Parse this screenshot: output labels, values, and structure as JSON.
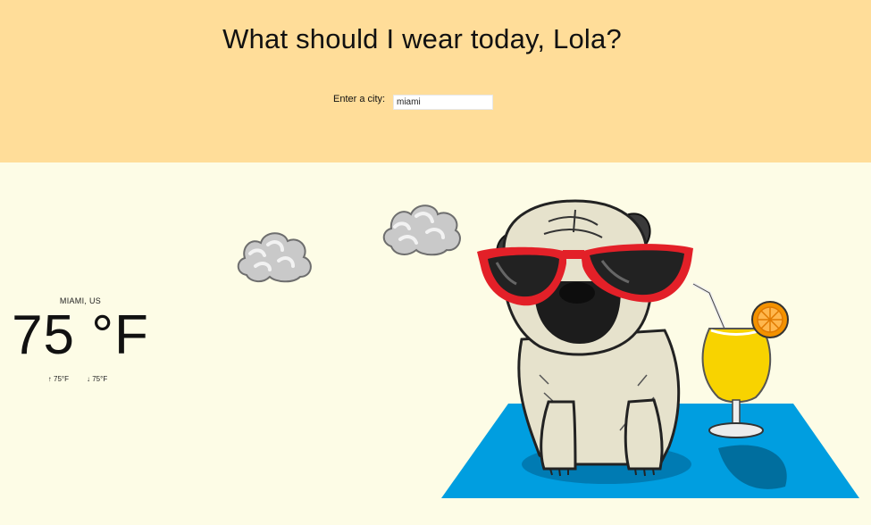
{
  "header": {
    "title": "What should I wear today, Lola?",
    "city_label": "Enter a city:",
    "city_value": "miami"
  },
  "weather": {
    "location": "MIAMI, US",
    "temperature": "75 °F",
    "high": "75°F",
    "low": "75°F",
    "high_arrow": "↑",
    "low_arrow": "↓"
  },
  "illustration": {
    "icons": [
      "cloud-icon",
      "cloud-icon",
      "pug-with-sunglasses",
      "cocktail-glass",
      "beach-towel"
    ]
  },
  "colors": {
    "header_bg": "#ffdd99",
    "page_bg": "#fdfce6",
    "towel": "#009ee0",
    "sunglasses": "#e32028"
  }
}
